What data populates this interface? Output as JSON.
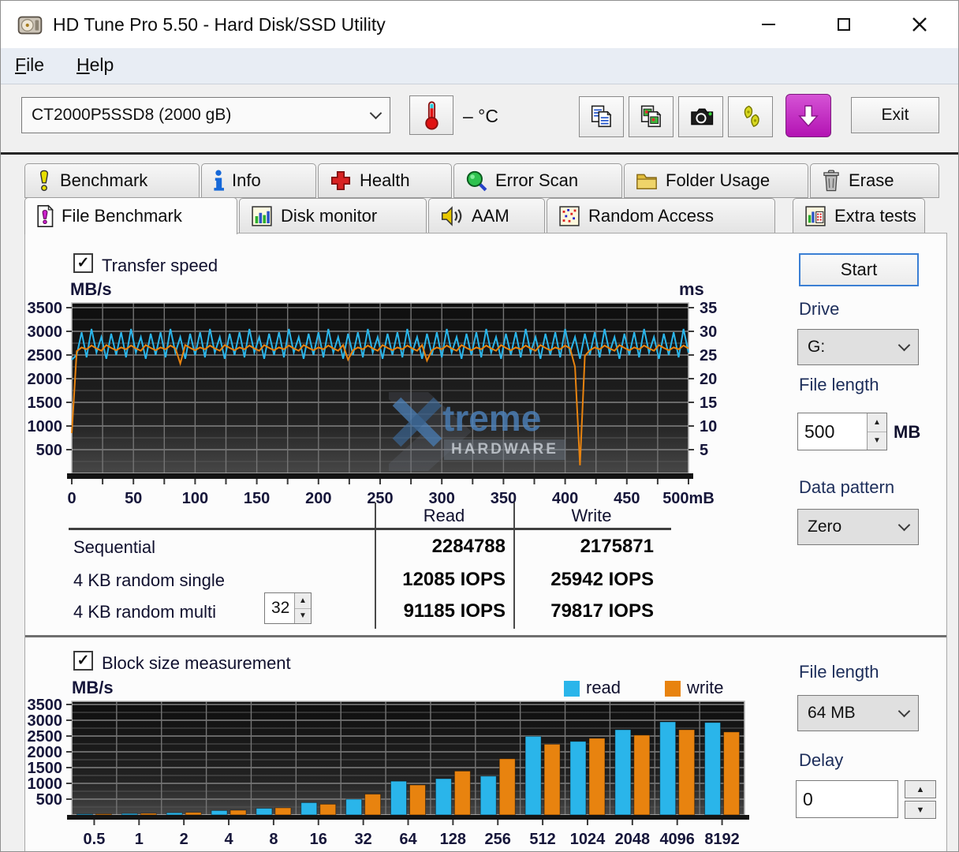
{
  "window": {
    "title": "HD Tune Pro 5.50 - Hard Disk/SSD Utility"
  },
  "menu": {
    "file": "File",
    "help": "Help"
  },
  "toolbar": {
    "drive_select": "CT2000P5SSD8 (2000 gB)",
    "temperature": "– °C",
    "exit": "Exit"
  },
  "tabs": {
    "benchmark": "Benchmark",
    "info": "Info",
    "health": "Health",
    "error_scan": "Error Scan",
    "folder_usage": "Folder Usage",
    "erase": "Erase",
    "file_benchmark": "File Benchmark",
    "disk_monitor": "Disk monitor",
    "aam": "AAM",
    "random_access": "Random Access",
    "extra_tests": "Extra tests"
  },
  "panel": {
    "transfer_speed": "Transfer speed",
    "start": "Start",
    "drive_label": "Drive",
    "drive_value": "G:",
    "file_length_label": "File length",
    "file_length_value": "500",
    "file_length_unit": "MB",
    "data_pattern_label": "Data pattern",
    "data_pattern_value": "Zero",
    "block_size": "Block size measurement",
    "legend_read": "read",
    "legend_write": "write",
    "file_length2_label": "File length",
    "file_length2_value": "64 MB",
    "delay_label": "Delay",
    "delay_value": "0"
  },
  "table": {
    "read": "Read",
    "write": "Write",
    "rows": [
      {
        "label": "Sequential",
        "read": "2284788",
        "write": "2175871"
      },
      {
        "label": "4 KB random single",
        "read": "12085 IOPS",
        "write": "25942 IOPS"
      },
      {
        "label": "4 KB random multi",
        "queue": "32",
        "read": "91185 IOPS",
        "write": "79817 IOPS"
      }
    ]
  },
  "watermark": {
    "name": "treme",
    "sub": "HARDWARE"
  },
  "colors": {
    "read": "#2ab5ea",
    "write": "#e8830f",
    "save_accent": "#c02cc0",
    "start_border": "#3b7fd4"
  },
  "chart_data": [
    {
      "type": "line",
      "title": "Transfer speed",
      "ylabel_left": "MB/s",
      "ylabel_right": "ms",
      "xlim": [
        0,
        500
      ],
      "ylim_left": [
        0,
        3600
      ],
      "ylim_right": [
        0,
        36
      ],
      "grid": true,
      "xtick_values": [
        0,
        50,
        100,
        150,
        200,
        250,
        300,
        350,
        400,
        450,
        500
      ],
      "xtick_labels": [
        "0",
        "50",
        "100",
        "150",
        "200",
        "250",
        "300",
        "350",
        "400",
        "450",
        "500mB"
      ],
      "yticks_left": [
        3500,
        3000,
        2500,
        2000,
        1500,
        1000,
        500
      ],
      "yticks_right": [
        35,
        30,
        25,
        20,
        15,
        10,
        5
      ],
      "x_step": 4,
      "series": [
        {
          "name": "read",
          "color": "#2ab5ea",
          "values": [
            2400,
            2500,
            2980,
            2450,
            3050,
            2550,
            2880,
            2420,
            2950,
            2500,
            2980,
            2450,
            3050,
            2550,
            2880,
            2420,
            2950,
            2500,
            2980,
            2450,
            3050,
            2550,
            2880,
            2420,
            2950,
            2500,
            2980,
            2450,
            3050,
            2550,
            2880,
            2420,
            2950,
            2500,
            2980,
            2450,
            3050,
            2550,
            2880,
            2420,
            2950,
            2500,
            2980,
            2450,
            3050,
            2550,
            2880,
            2420,
            2950,
            2500,
            2980,
            2450,
            3050,
            2550,
            2880,
            2420,
            2950,
            2500,
            2980,
            2450,
            3050,
            2550,
            2880,
            2420,
            2950,
            2500,
            2980,
            2450,
            3050,
            2550,
            2880,
            2420,
            2950,
            2500,
            2980,
            2450,
            3050,
            2550,
            2880,
            2420,
            2950,
            2500,
            2980,
            2450,
            3050,
            2550,
            2880,
            2420,
            2950,
            2500,
            2980,
            2450,
            3050,
            2550,
            2880,
            2420,
            2950,
            2500,
            2980,
            2450,
            3050,
            2550,
            2880,
            2420,
            2950,
            2500,
            2980,
            2450,
            3050,
            2550,
            2880,
            2420,
            2950,
            2500,
            2980,
            2450,
            3050,
            2550,
            2880,
            2420,
            2950,
            2500,
            2980,
            2450,
            3050,
            2550
          ]
        },
        {
          "name": "write",
          "color": "#e8830f",
          "values": [
            850,
            2580,
            2660,
            2620,
            2700,
            2640,
            2590,
            2710,
            2650,
            2600,
            2660,
            2620,
            2700,
            2640,
            2590,
            2710,
            2650,
            2600,
            2660,
            2620,
            2700,
            2640,
            2320,
            2710,
            2650,
            2600,
            2660,
            2620,
            2700,
            2640,
            2590,
            2710,
            2650,
            2600,
            2660,
            2620,
            2700,
            2640,
            2590,
            2710,
            2650,
            2600,
            2660,
            2620,
            2700,
            2640,
            2590,
            2710,
            2650,
            2600,
            2660,
            2620,
            2700,
            2640,
            2590,
            2710,
            2400,
            2600,
            2660,
            2620,
            2700,
            2640,
            2590,
            2710,
            2650,
            2600,
            2660,
            2620,
            2700,
            2640,
            2590,
            2710,
            2380,
            2600,
            2660,
            2620,
            2700,
            2640,
            2590,
            2710,
            2650,
            2600,
            2660,
            2620,
            2700,
            2640,
            2590,
            2710,
            2650,
            2600,
            2660,
            2620,
            2700,
            2640,
            2590,
            2710,
            2650,
            2600,
            2660,
            2620,
            2700,
            2640,
            2250,
            170,
            2480,
            2600,
            2660,
            2620,
            2700,
            2640,
            2590,
            2710,
            2650,
            2600,
            2660,
            2620,
            2700,
            2640,
            2590,
            2710,
            2650,
            2600,
            2660,
            2620,
            2700,
            2640
          ]
        }
      ]
    },
    {
      "type": "bar",
      "ylabel": "MB/s",
      "categories": [
        "0.5",
        "1",
        "2",
        "4",
        "8",
        "16",
        "32",
        "64",
        "128",
        "256",
        "512",
        "1024",
        "2048",
        "4096",
        "8192"
      ],
      "yticks": [
        3500,
        3000,
        2500,
        2000,
        1500,
        1000,
        500
      ],
      "ylim": [
        0,
        3600
      ],
      "grid": true,
      "legend_position": "top-right",
      "series": [
        {
          "name": "read",
          "color": "#2ab5ea",
          "values": [
            30,
            45,
            70,
            140,
            210,
            390,
            500,
            1070,
            1150,
            1230,
            2490,
            2330,
            2700,
            2950,
            2930
          ]
        },
        {
          "name": "write",
          "color": "#e8830f",
          "values": [
            33,
            50,
            80,
            150,
            225,
            340,
            660,
            950,
            1390,
            1780,
            2240,
            2430,
            2530,
            2700,
            2630
          ]
        }
      ]
    }
  ]
}
